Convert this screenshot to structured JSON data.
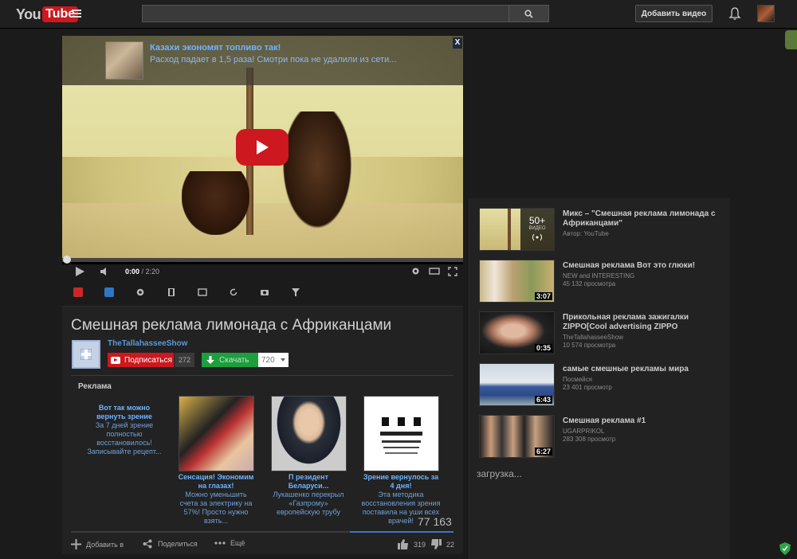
{
  "header": {
    "logo_you": "You",
    "logo_tube": "Tube",
    "search_placeholder": "",
    "upload_label": "Добавить видео"
  },
  "player": {
    "ad_title": "Казахи экономят топливо так!",
    "ad_text": "Расход падает в 1,5 раза! Смотри пока не удалили из сети...",
    "ad_close": "X",
    "time_current": "0:00",
    "time_total": "2:20",
    "progress_fraction": 0.0
  },
  "video": {
    "title": "Смешная реклама лимонада с Африканцами",
    "channel": "TheTallahasseeShow",
    "subscribe_label": "Подписаться",
    "subscriber_count": "272",
    "download_label": "Скачать",
    "quality": "720",
    "views": "77 163",
    "add_to_label": "Добавить в",
    "share_label": "Поделиться",
    "more_label": "Ещё",
    "likes": "319",
    "dislikes": "22"
  },
  "ads": {
    "label": "Реклама",
    "cards": [
      {
        "headline": "Вот так можно вернуть зрение",
        "desc": "За 7 дней зрение полностью восстановилось! Записывайте рецепт..."
      },
      {
        "headline": "Сенсация! Экономим на глазах!",
        "desc": "Можно уменьшить счета за электрику на 57%! Просто нужно взять..."
      },
      {
        "headline": "П резидент Беларуси...",
        "desc": "Лукашенко перекрыл «Газпрому» европейскую трубу"
      },
      {
        "headline": "Зрение вернулось за 4 дня!",
        "desc": "Эта методика восстановления зрения поставила на уши всех врачей!"
      }
    ]
  },
  "sidebar": {
    "items": [
      {
        "title": "Микс – \"Смешная реклама лимонада с Африканцами\"",
        "channel": "Автор: YouTube",
        "views": "",
        "duration": "",
        "mix_count": "50+",
        "mix_label": "ВИДЕО"
      },
      {
        "title": "Смешная реклама Вот это глюки!",
        "channel": "NEW and INTERESTING",
        "views": "45 132 просмотра",
        "duration": "3:07"
      },
      {
        "title": "Прикольная реклама зажигалки ZIPPO[Cool advertising ZIPPO",
        "channel": "TheTallahasseeShow",
        "views": "10 574 просмотра",
        "duration": "0:35"
      },
      {
        "title": "самые смешные рекламы мира",
        "channel": "Посмейся",
        "views": "23 401 просмотр",
        "duration": "6:43"
      },
      {
        "title": "Смешная реклама #1",
        "channel": "UGARPRIKOL",
        "views": "283 308 просмотр",
        "duration": "6:27"
      }
    ],
    "loading": "загрузка..."
  },
  "colors": {
    "youtube_red": "#cc181e",
    "link_blue": "#6fb4ff",
    "download_green": "#1c9f3c"
  }
}
